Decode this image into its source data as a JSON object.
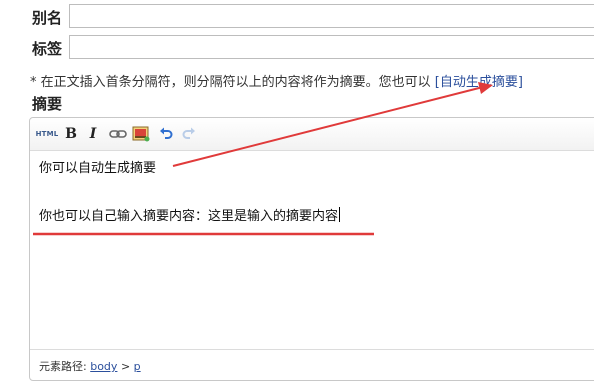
{
  "form": {
    "alias_label": "别名",
    "alias_value": "",
    "tags_label": "标签",
    "tags_value": ""
  },
  "hint": {
    "prefix": "* 在正文插入首条分隔符，则分隔符以上的内容将作为摘要。您也可以",
    "link": "[自动生成摘要]"
  },
  "summary": {
    "label": "摘要",
    "toolbar": {
      "html_label": "HTML",
      "bold_label": "B",
      "italic_label": "I",
      "icons": [
        "link-icon",
        "image-icon",
        "undo-icon",
        "redo-icon"
      ]
    },
    "content": {
      "line1": "你可以自动生成摘要",
      "line2": "你也可以自己输入摘要内容：这里是输入的摘要内容"
    },
    "statusbar": {
      "path_label": "元素路径:",
      "path_body": "body",
      "separator": ">",
      "path_p": "p"
    }
  },
  "annotation_color": "#e03a3a",
  "link_color": "#2b4f9c"
}
